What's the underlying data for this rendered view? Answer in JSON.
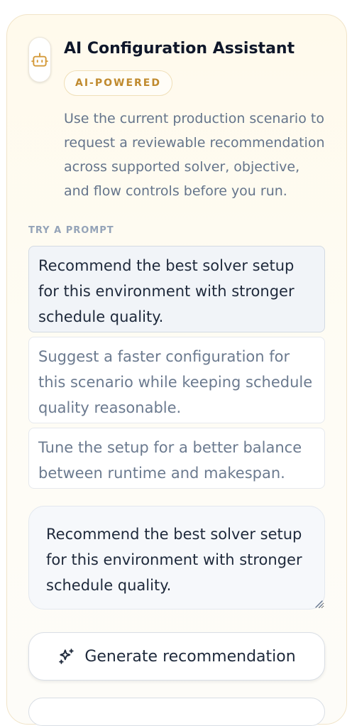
{
  "assistant": {
    "title": "AI Configuration Assistant",
    "badge": "AI-POWERED",
    "description": "Use the current production scenario to request a reviewable recommendation across supported solver, objective, and flow controls before you run.",
    "icon": "robot-icon",
    "accent_color": "#d49a3a"
  },
  "prompts": {
    "section_label": "TRY A PROMPT",
    "items": [
      {
        "label": "Recommend the best solver setup for this environment with stronger schedule quality.",
        "selected": true
      },
      {
        "label": "Suggest a faster configuration for this scenario while keeping schedule quality reasonable.",
        "selected": false
      },
      {
        "label": "Tune the setup for a better balance between runtime and makespan.",
        "selected": false
      }
    ]
  },
  "input": {
    "value": "Recommend the best solver setup for this environment with stronger schedule quality."
  },
  "actions": {
    "generate_label": "Generate recommendation",
    "generate_icon": "sparkles-icon"
  }
}
